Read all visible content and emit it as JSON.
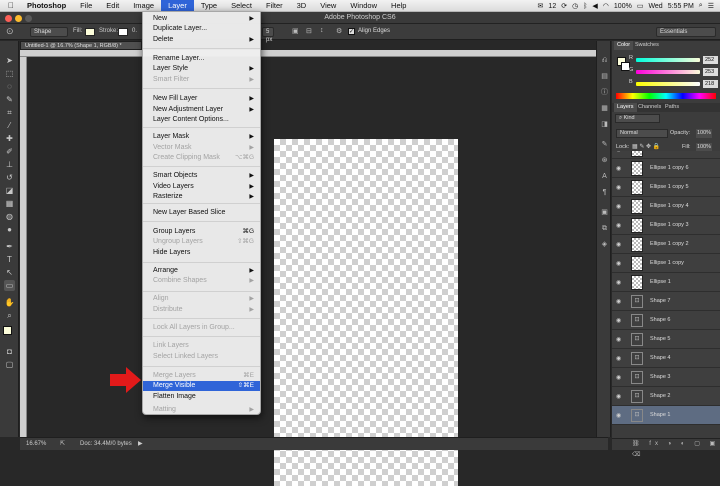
{
  "menubar": {
    "apple": "",
    "items": [
      "Photoshop",
      "File",
      "Edit",
      "Image",
      "Layer",
      "Type",
      "Select",
      "Filter",
      "3D",
      "View",
      "Window",
      "Help"
    ],
    "status_num": "12",
    "battery": "100%",
    "day": "Wed",
    "time": "5:55 PM"
  },
  "window": {
    "title": "Adobe Photoshop CS6",
    "workspace": "Essentials"
  },
  "options": {
    "mode": "Shape",
    "fill_label": "Fill:",
    "stroke_label": "Stroke:",
    "stroke_width_partial": "0.",
    "size_partial": "5 px",
    "align_edges": "Align Edges"
  },
  "document": {
    "tab_title": "Untitled-1 @ 16.7% (Shape 1, RGB/8) *",
    "zoom": "16.67%",
    "doc_info": "Doc: 34.4M/0 bytes"
  },
  "layer_menu": {
    "items": [
      {
        "label": "New",
        "submenu": true,
        "disabled": false
      },
      {
        "label": "Duplicate Layer...",
        "disabled": false
      },
      {
        "label": "Delete",
        "submenu": true,
        "disabled": false
      },
      {
        "label": "Rename Layer...",
        "disabled": false
      },
      {
        "label": "Layer Style",
        "submenu": true,
        "disabled": false
      },
      {
        "label": "Smart Filter",
        "submenu": true,
        "disabled": true
      },
      {
        "label": "New Fill Layer",
        "submenu": true,
        "disabled": false
      },
      {
        "label": "New Adjustment Layer",
        "submenu": true,
        "disabled": false
      },
      {
        "label": "Layer Content Options...",
        "disabled": false
      },
      {
        "label": "Layer Mask",
        "submenu": true,
        "disabled": false
      },
      {
        "label": "Vector Mask",
        "submenu": true,
        "disabled": true
      },
      {
        "label": "Create Clipping Mask",
        "shortcut": "⌥⌘G",
        "disabled": true
      },
      {
        "label": "Smart Objects",
        "submenu": true,
        "disabled": false
      },
      {
        "label": "Video Layers",
        "submenu": true,
        "disabled": false
      },
      {
        "label": "Rasterize",
        "submenu": true,
        "disabled": false
      },
      {
        "label": "New Layer Based Slice",
        "disabled": false
      },
      {
        "label": "Group Layers",
        "shortcut": "⌘G",
        "disabled": false
      },
      {
        "label": "Ungroup Layers",
        "shortcut": "⇧⌘G",
        "disabled": true
      },
      {
        "label": "Hide Layers",
        "disabled": false
      },
      {
        "label": "Arrange",
        "submenu": true,
        "disabled": false
      },
      {
        "label": "Combine Shapes",
        "submenu": true,
        "disabled": true
      },
      {
        "label": "Align",
        "submenu": true,
        "disabled": true
      },
      {
        "label": "Distribute",
        "submenu": true,
        "disabled": true
      },
      {
        "label": "Lock All Layers in Group...",
        "disabled": true
      },
      {
        "label": "Link Layers",
        "disabled": true
      },
      {
        "label": "Select Linked Layers",
        "disabled": true
      },
      {
        "label": "Merge Layers",
        "shortcut": "⌘E",
        "disabled": true
      },
      {
        "label": "Merge Visible",
        "shortcut": "⇧⌘E",
        "disabled": false,
        "highlighted": true
      },
      {
        "label": "Flatten Image",
        "disabled": false
      },
      {
        "label": "Matting",
        "submenu": true,
        "disabled": true
      }
    ]
  },
  "color_panel": {
    "tabs": [
      "Color",
      "Swatches"
    ],
    "r": "252",
    "g": "253",
    "b": "218",
    "r_label": "R",
    "g_label": "G",
    "b_label": "B"
  },
  "layers_panel": {
    "tabs": [
      "Layers",
      "Channels",
      "Paths"
    ],
    "kind": "Kind",
    "blend_mode": "Normal",
    "opacity_label": "Opacity:",
    "opacity": "100%",
    "lock_label": "Lock:",
    "fill_label": "Fill:",
    "fill": "100%",
    "layers": [
      {
        "name": "Ellipse 1 copy 7",
        "type": "raster",
        "selected": false
      },
      {
        "name": "Ellipse 1 copy 6",
        "type": "raster",
        "selected": false
      },
      {
        "name": "Ellipse 1 copy 5",
        "type": "raster",
        "selected": false
      },
      {
        "name": "Ellipse 1 copy 4",
        "type": "raster",
        "selected": false
      },
      {
        "name": "Ellipse 1 copy 3",
        "type": "raster",
        "selected": false
      },
      {
        "name": "Ellipse 1 copy 2",
        "type": "raster",
        "selected": false
      },
      {
        "name": "Ellipse 1 copy",
        "type": "raster",
        "selected": false
      },
      {
        "name": "Ellipse 1",
        "type": "raster",
        "selected": false
      },
      {
        "name": "Shape 7",
        "type": "vector",
        "selected": false
      },
      {
        "name": "Shape 6",
        "type": "vector",
        "selected": false
      },
      {
        "name": "Shape 5",
        "type": "vector",
        "selected": false
      },
      {
        "name": "Shape 4",
        "type": "vector",
        "selected": false
      },
      {
        "name": "Shape 3",
        "type": "vector",
        "selected": false
      },
      {
        "name": "Shape 2",
        "type": "vector",
        "selected": false
      },
      {
        "name": "Shape 1",
        "type": "vector",
        "selected": true
      }
    ]
  }
}
